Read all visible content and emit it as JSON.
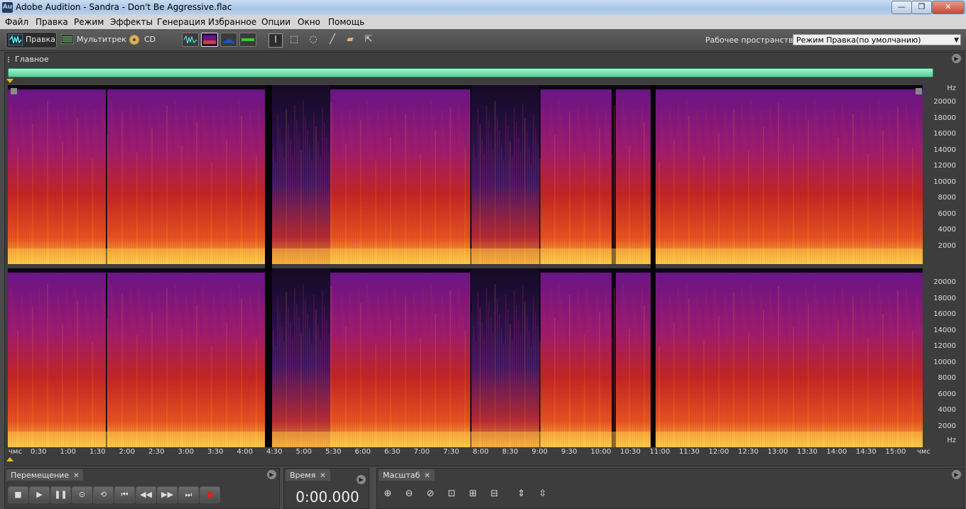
{
  "window": {
    "app_icon": "Au",
    "title": "Adobe Audition - Sandra - Don't Be Aggressive.flac",
    "caption_buttons": [
      "—",
      "❐",
      "✕"
    ]
  },
  "menu": [
    "Файл",
    "Правка",
    "Режим",
    "Эффекты",
    "Генерация",
    "Избранное",
    "Опции",
    "Окно",
    "Помощь"
  ],
  "toolbar": {
    "modes": [
      {
        "label": "Правка",
        "icon": "waveform-edit-icon",
        "active": true
      },
      {
        "label": "Мультитрек",
        "icon": "multitrack-icon",
        "active": false
      },
      {
        "label": "CD",
        "icon": "cd-icon",
        "active": false
      }
    ],
    "view_icons": [
      "waveform-view-icon",
      "spectral-view-icon",
      "pan-view-icon",
      "phase-view-icon"
    ],
    "tool_icons": [
      "time-selection-tool-icon",
      "marquee-tool-icon",
      "lasso-tool-icon",
      "brush-tool-icon",
      "healing-tool-icon",
      "scrub-tool-icon"
    ],
    "workspace_label": "Рабочее пространство:",
    "workspace_value": "Режим Правка(по умолчанию)"
  },
  "main_panel": {
    "tab_label": "Главное",
    "view": "spectral-frequency",
    "channels": 2,
    "freq_unit": "Hz",
    "freq_labels": [
      "20000",
      "18000",
      "16000",
      "14000",
      "12000",
      "10000",
      "8000",
      "6000",
      "4000",
      "2000"
    ],
    "time_unit": "чмс",
    "time_ticks": [
      "0:30",
      "1:00",
      "1:30",
      "2:00",
      "2:30",
      "3:00",
      "3:30",
      "4:00",
      "4:30",
      "5:00",
      "5:30",
      "6:00",
      "6:30",
      "7:00",
      "7:30",
      "8:00",
      "8:30",
      "9:00",
      "9:30",
      "10:00",
      "10:30",
      "11:00",
      "11:30",
      "12:00",
      "12:30",
      "13:00",
      "13:30",
      "14:00",
      "14:30",
      "15:00"
    ],
    "colors": {
      "low": "#0b0612",
      "mid": "#6a1585",
      "high": "#c0241f",
      "peak": "#ffd048"
    }
  },
  "transport": {
    "tab_label": "Перемещение",
    "buttons": [
      {
        "name": "stop",
        "icon": "■"
      },
      {
        "name": "play",
        "icon": "▶"
      },
      {
        "name": "pause",
        "icon": "❚❚"
      },
      {
        "name": "play-from-cursor",
        "icon": "⊙"
      },
      {
        "name": "loop",
        "icon": "⟲"
      },
      {
        "name": "go-to-start",
        "icon": "⏮"
      },
      {
        "name": "rewind",
        "icon": "◀◀"
      },
      {
        "name": "fast-forward",
        "icon": "▶▶"
      },
      {
        "name": "go-to-end",
        "icon": "⏭"
      },
      {
        "name": "record",
        "icon": "●"
      }
    ]
  },
  "time_panel": {
    "tab_label": "Время",
    "value": "0:00.000"
  },
  "zoom_panel": {
    "tab_label": "Масштаб",
    "buttons": [
      "⊕",
      "⊖",
      "⊘",
      "⊡",
      "⊞",
      "⊟",
      "⇕",
      "⇳"
    ]
  }
}
